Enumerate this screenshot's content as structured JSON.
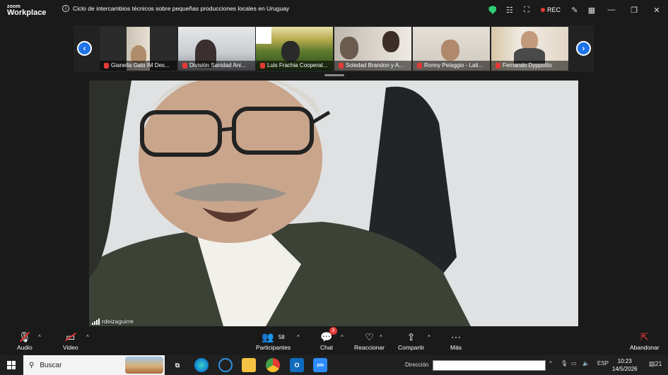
{
  "app": {
    "logo_line1": "zoom",
    "logo_line2": "Workplace"
  },
  "meeting": {
    "title": "Ciclo de intercambios técnicos sobre pequeñas producciones locales en Uruguay",
    "rec_label": "REC"
  },
  "participants_strip": [
    {
      "name": "Gianella Galo IM Des..."
    },
    {
      "name": "División Sanidad Ani..."
    },
    {
      "name": "Luis Frachia Cooperat..."
    },
    {
      "name": "Soledad Brandon y A..."
    },
    {
      "name": "Ronny Pelaggio - Lati..."
    },
    {
      "name": "Fernando Dyppolito"
    }
  ],
  "active_speaker": {
    "name": "rdeizaguirre"
  },
  "toolbar": {
    "audio": "Audio",
    "video": "Video",
    "participants": "Participantes",
    "participants_count": "58",
    "chat": "Chat",
    "chat_badge": "3",
    "react": "Reaccionar",
    "share": "Compartir",
    "more": "Más",
    "leave": "Abandonar"
  },
  "taskbar": {
    "search_placeholder": "Buscar",
    "address_label": "Dirección",
    "language": "ESP",
    "time": "10:23",
    "date": "14/5/2026",
    "notif_count": "21"
  },
  "colors": {
    "accent": "#1e73e8",
    "rec": "#e53935",
    "shield": "#2ecc71"
  }
}
